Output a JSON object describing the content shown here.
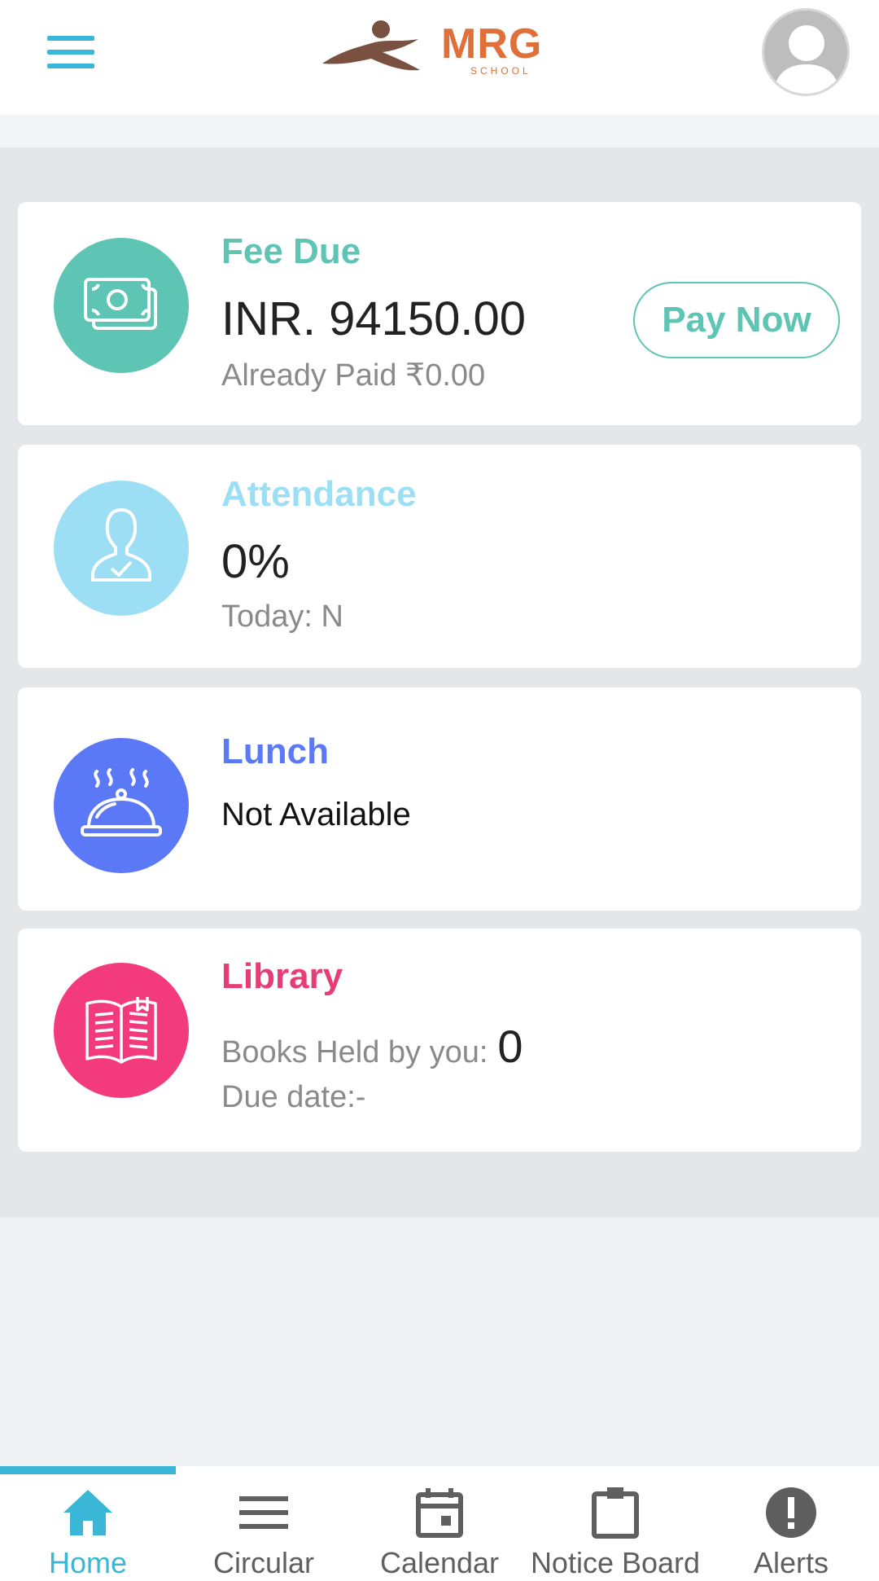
{
  "header": {
    "logo_text": "MRG",
    "logo_subtext": "SCHOOL",
    "menu_icon": "hamburger-menu-icon",
    "avatar_icon": "user-avatar-icon"
  },
  "colors": {
    "accent": "#3ab7d6",
    "fee": "#5ec4b4",
    "attendance": "#9cdff5",
    "lunch": "#5b79f7",
    "library": "#f23a7d",
    "logo": "#e0703a"
  },
  "cards": {
    "fee": {
      "title": "Fee Due",
      "amount": "INR. 94150.00",
      "paid": "Already Paid ₹0.00",
      "button": "Pay Now",
      "icon": "money-icon"
    },
    "attendance": {
      "title": "Attendance",
      "value": "0%",
      "today": "Today: N",
      "icon": "user-check-icon"
    },
    "lunch": {
      "title": "Lunch",
      "status": "Not Available",
      "icon": "food-cloche-icon"
    },
    "library": {
      "title": "Library",
      "books_label": "Books Held by you:",
      "books_count": "0",
      "due_date": "Due date:-",
      "icon": "book-icon"
    }
  },
  "bottom_nav": {
    "items": [
      {
        "label": "Home",
        "icon": "home-icon",
        "active": true
      },
      {
        "label": "Circular",
        "icon": "list-icon"
      },
      {
        "label": "Calendar",
        "icon": "calendar-icon"
      },
      {
        "label": "Notice Board",
        "icon": "clipboard-icon"
      },
      {
        "label": "Alerts",
        "icon": "alert-icon"
      }
    ]
  }
}
